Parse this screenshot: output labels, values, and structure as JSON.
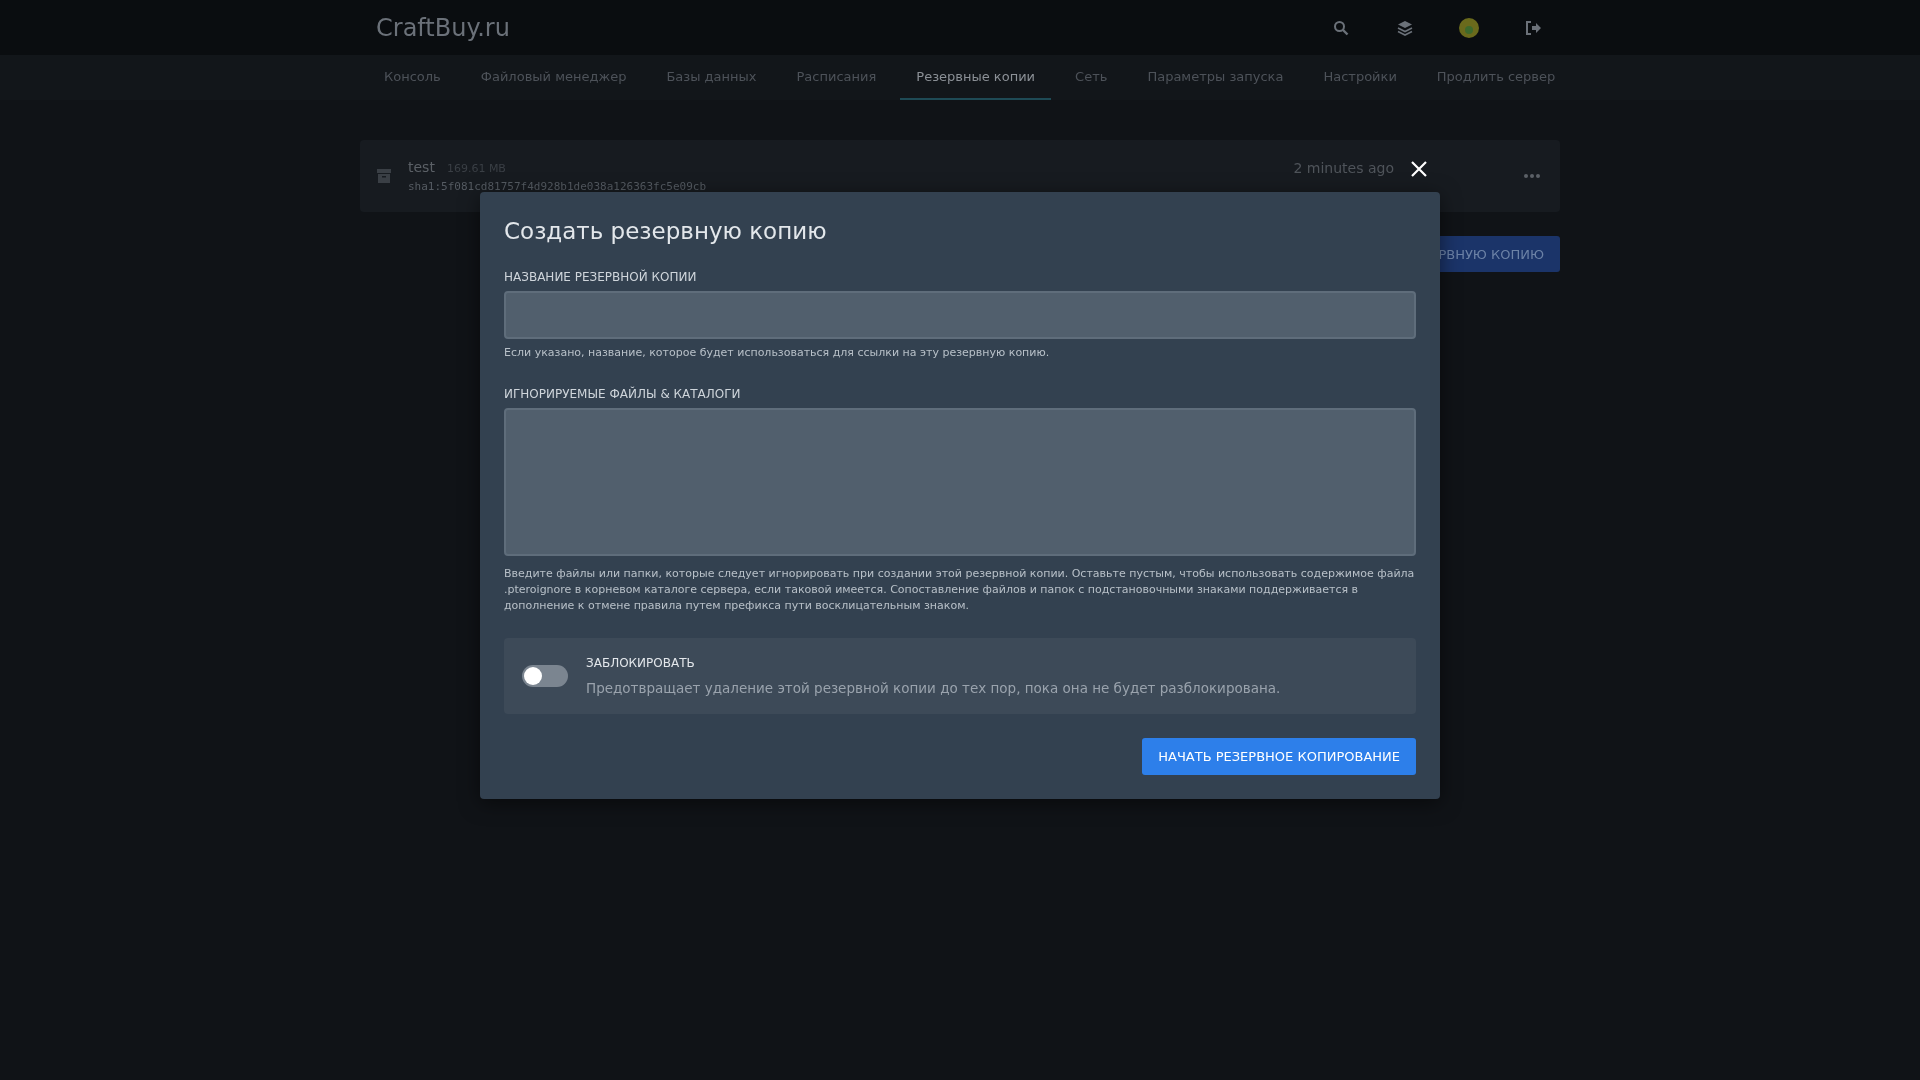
{
  "header": {
    "logo": "CraftBuy.ru"
  },
  "nav": [
    {
      "label": "Консоль",
      "selected": false
    },
    {
      "label": "Файловый менеджер",
      "selected": false
    },
    {
      "label": "Базы данных",
      "selected": false
    },
    {
      "label": "Расписания",
      "selected": false
    },
    {
      "label": "Резервные копии",
      "selected": true
    },
    {
      "label": "Сеть",
      "selected": false
    },
    {
      "label": "Параметры запуска",
      "selected": false
    },
    {
      "label": "Настройки",
      "selected": false
    },
    {
      "label": "Продлить сервер",
      "selected": false
    }
  ],
  "backups": [
    {
      "name": "test",
      "size": "169.61 MB",
      "checksum": "sha1:5f081cd81757f4d928b1de038a126363fc5e09cb",
      "created": "2 minutes ago"
    }
  ],
  "create_button": "РВНУЮ КОПИЮ",
  "modal": {
    "title": "Создать резервную копию",
    "name_field": {
      "label": "НАЗВАНИЕ РЕЗЕРВНОЙ КОПИИ",
      "hint": "Если указано, название, которое будет использоваться для ссылки на эту резервную копию."
    },
    "ignored_field": {
      "label": "ИГНОРИРУЕМЫЕ ФАЙЛЫ & КАТАЛОГИ",
      "hint": "Введите файлы или папки, которые следует игнорировать при создании этой резервной копии. Оставьте пустым, чтобы использовать содержимое файла .pteroignore в корневом каталоге сервера, если таковой имеется. Сопоставление файлов и папок с подстановочными знаками поддерживается в дополнение к отмене правила путем префикса пути восклицательным знаком."
    },
    "lock": {
      "label": "ЗАБЛОКИРОВАТЬ",
      "description": "Предотвращает удаление этой резервной копии до тех пор, пока она не будет разблокирована.",
      "on": false
    },
    "submit": "НАЧАТЬ РЕЗЕРВНОЕ КОПИРОВАНИЕ"
  }
}
